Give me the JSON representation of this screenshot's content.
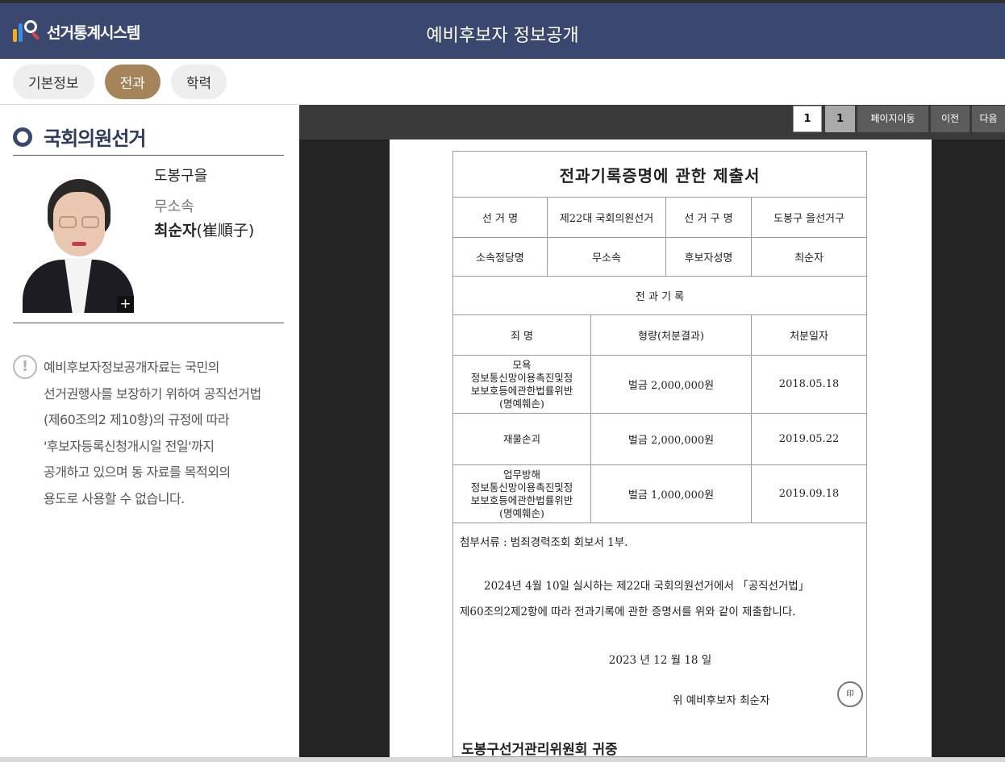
{
  "header": {
    "logo_text": "선거통계시스템",
    "title": "예비후보자 정보공개"
  },
  "tabs": [
    {
      "label": "기본정보",
      "active": false
    },
    {
      "label": "전과",
      "active": true
    },
    {
      "label": "학력",
      "active": false
    }
  ],
  "sidebar": {
    "election_type": "국회의원선거",
    "district": "도봉구을",
    "party": "무소속",
    "name": "최순자",
    "name_hanja": "(崔順子)",
    "photo_zoom_icon": "+",
    "notice_icon": "!",
    "notice_lines": [
      "예비후보자정보공개자료는 국민의",
      "선거권행사를 보장하기 위하여 공직선거법",
      "(제60조의2 제10항)의 규정에 따라",
      "'후보자등록신청개시일 전일'까지",
      "공개하고 있으며 동 자료를 목적외의",
      "용도로 사용할 수 없습니다."
    ]
  },
  "viewer": {
    "page_input": "1",
    "page_total": "1",
    "goto_label": "페이지이동",
    "prev_label": "이전",
    "next_label": "다음"
  },
  "document": {
    "title": "전과기록증명에 관한 제출서",
    "election_name_label": "선 거 명",
    "election_name_value": "제22대 국회의원선거",
    "district_label": "선 거 구 명",
    "district_value": "도봉구 을선거구",
    "party_label": "소속정당명",
    "party_value": "무소속",
    "candidate_label": "후보자성명",
    "candidate_value": "최순자",
    "record_header": "전 과 기 록",
    "col_crime": "죄 명",
    "col_penalty": "형량(처분결과)",
    "col_date": "처분일자",
    "records": [
      {
        "crime_lines": [
          "모욕",
          "정보통신망이용촉진및정",
          "보보호등에관한법률위반",
          "(명예훼손)"
        ],
        "penalty": "벌금 2,000,000원",
        "date": "2018.05.18"
      },
      {
        "crime_lines": [
          "재물손괴"
        ],
        "penalty": "벌금 2,000,000원",
        "date": "2019.05.22"
      },
      {
        "crime_lines": [
          "업무방해",
          "정보통신망이용촉진및정",
          "보보호등에관한법률위반",
          "(명예훼손)"
        ],
        "penalty": "벌금 1,000,000원",
        "date": "2019.09.18"
      }
    ],
    "attachment": "첨부서류 : 범죄경력조회 회보서 1부.",
    "statement_line1": "2024년 4월 10일 실시하는 제22대 국회의원선거에서 「공직선거법」",
    "statement_line2": "제60조의2제2항에 따라 전과기록에 관한 증명서를 위와 같이 제출합니다.",
    "date": "2023 년 12 월 18 일",
    "sign_line": "위      예비후보자   최순자",
    "seal_text": "印",
    "addressee": "도봉구선거관리위원회 귀중"
  }
}
